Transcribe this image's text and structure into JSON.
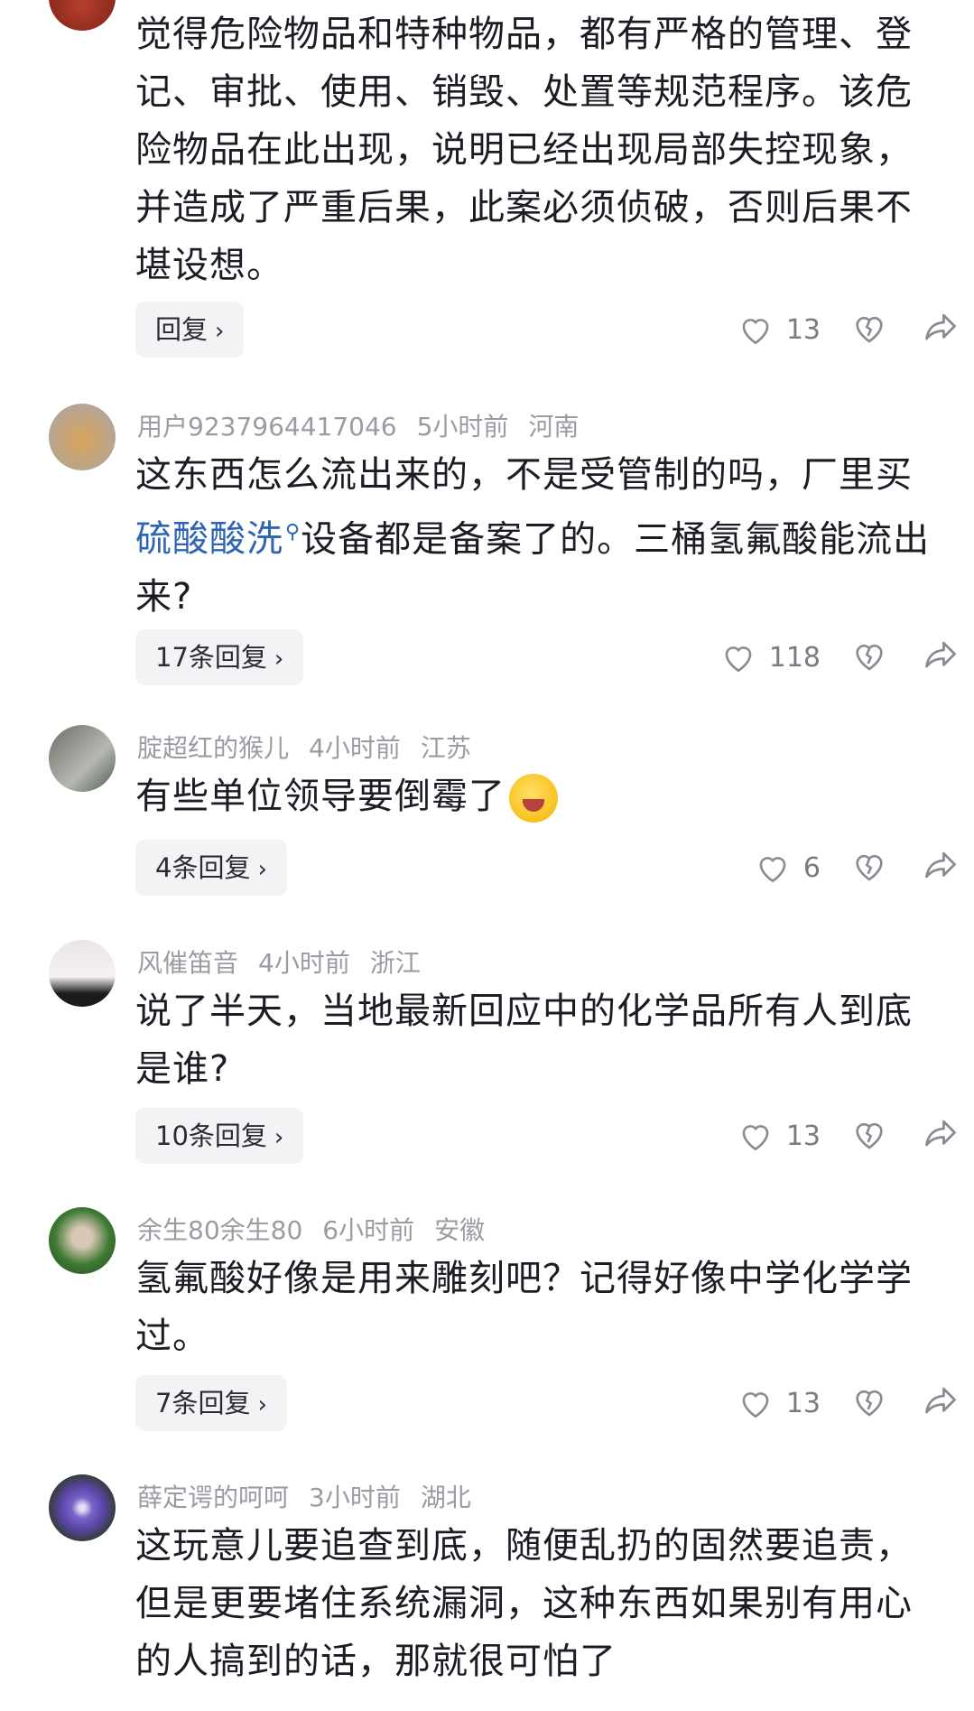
{
  "comments": [
    {
      "user": "",
      "time": "",
      "location": "",
      "text": "觉得危险物品和特种物品，都有严格的管理、登记、审批、使用、销毁、处置等规范程序。该危险物品在此出现，说明已经出现局部失控现象，并造成了严重后果，此案必须侦破，否则后果不堪设想。",
      "reply_label": "回复",
      "likes": "13"
    },
    {
      "user": "用户9237964417046",
      "time": "5小时前",
      "location": "河南",
      "text_before": "这东西怎么流出来的，不是受管制的吗，厂里买",
      "hashtag": "硫酸酸洗",
      "text_after": "设备都是备案了的。三桶氢氟酸能流出来?",
      "reply_label": "17条回复",
      "likes": "118"
    },
    {
      "user": "腚超红的猴儿",
      "time": "4小时前",
      "location": "江苏",
      "text": "有些单位领导要倒霉了",
      "reply_label": "4条回复",
      "likes": "6"
    },
    {
      "user": "风催笛音",
      "time": "4小时前",
      "location": "浙江",
      "text": "说了半天，当地最新回应中的化学品所有人到底是谁?",
      "reply_label": "10条回复",
      "likes": "13"
    },
    {
      "user": "余生80余生80",
      "time": "6小时前",
      "location": "安徽",
      "text": "氢氟酸好像是用来雕刻吧？记得好像中学化学学过。",
      "reply_label": "7条回复",
      "likes": "13"
    },
    {
      "user": "薛定谔的呵呵",
      "time": "3小时前",
      "location": "湖北",
      "text": "这玩意儿要追查到底，随便乱扔的固然要追责，但是更要堵住系统漏洞，这种东西如果别有用心的人搞到的话，那就很可怕了"
    }
  ],
  "icons": {
    "like": "heart-outline-icon",
    "dislike": "broken-heart-icon",
    "share": "share-arrow-icon",
    "chevron": "chevron-right-icon",
    "search_mark": "search-mini-icon",
    "emoji": "laughing-crying-emoji"
  },
  "colors": {
    "text": "#1c1d24",
    "meta": "#9b9ba3",
    "hashtag": "#2d64b3",
    "button_bg": "#f3f3f5",
    "icon": "#8a8a92"
  }
}
